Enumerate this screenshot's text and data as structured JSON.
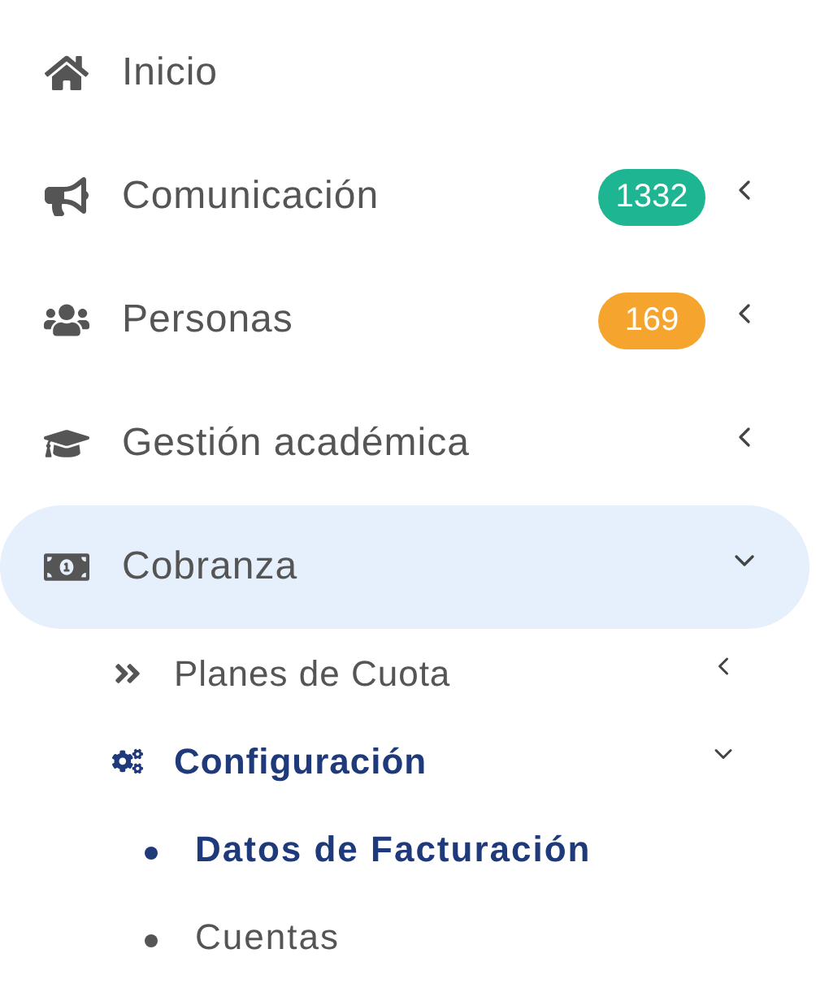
{
  "menu": [
    {
      "label": "Inicio",
      "selected": false
    },
    {
      "label": "Comunicación",
      "badge": {
        "text": "1332",
        "color": "#1db592"
      },
      "expanded": false,
      "selected": false
    },
    {
      "label": "Personas",
      "badge": {
        "text": "169",
        "color": "#f5a52e"
      },
      "expanded": false,
      "selected": false
    },
    {
      "label": "Gestión académica",
      "expanded": false,
      "selected": false
    },
    {
      "label": "Cobranza",
      "expanded": true,
      "selected": true,
      "children": [
        {
          "label": "Planes de Cuota",
          "expanded": false,
          "selected": false
        },
        {
          "label": "Configuración",
          "expanded": true,
          "selected": true,
          "children": [
            {
              "label": "Datos de Facturación",
              "selected": true
            },
            {
              "label": "Cuentas",
              "selected": false
            }
          ]
        }
      ]
    }
  ]
}
